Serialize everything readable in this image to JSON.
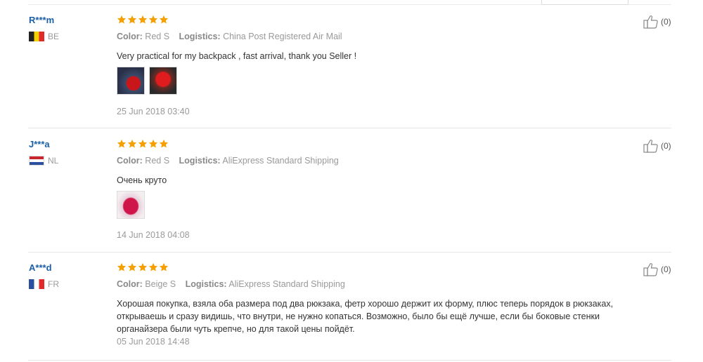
{
  "reviews": [
    {
      "user": "R***m",
      "country": "BE",
      "flag_colors": [
        "#222222",
        "#f5d000",
        "#e12b2b"
      ],
      "rating": 5,
      "color_label": "Color:",
      "color_value": "Red S",
      "logistics_label": "Logistics:",
      "logistics_value": "China Post Registered Air Mail",
      "text": "Very practical for my backpack , fast arrival, thank you Seller !",
      "photos": 2,
      "date": "25 Jun 2018 03:40",
      "likes": "(0)"
    },
    {
      "user": "J***a",
      "country": "NL",
      "flag_colors": [
        "#c8262c",
        "#ffffff",
        "#2a4f9e"
      ],
      "rating": 5,
      "color_label": "Color:",
      "color_value": "Red S",
      "logistics_label": "Logistics:",
      "logistics_value": "AliExpress Standard Shipping",
      "text": "Очень круто",
      "photos": 1,
      "date": "14 Jun 2018 04:08",
      "likes": "(0)"
    },
    {
      "user": "A***d",
      "country": "FR",
      "flag_colors": [
        "#2a4f9e",
        "#ffffff",
        "#e12b2b"
      ],
      "rating": 5,
      "color_label": "Color:",
      "color_value": "Beige S",
      "logistics_label": "Logistics:",
      "logistics_value": "AliExpress Standard Shipping",
      "text_lines": [
        "Хорошая покупка, взяла оба размера под два рюкзака, фетр хорошо держит их форму, плюс теперь порядок в рюкзаках,",
        "открываешь и сразу видишь, что внутри, не нужно копаться. Возможно, было бы ещё лучше, если бы боковые стенки",
        "органайзера были чуть крепче, но для такой цены пойдёт."
      ],
      "photos": 0,
      "date": "05 Jun 2018 14:48",
      "likes": "(0)"
    }
  ],
  "colors": {
    "star": "#f5a000",
    "username": "#1b5fa6",
    "meta": "#999999"
  },
  "icons": {
    "rating": "star-icon",
    "like": "thumbs-up-icon"
  }
}
